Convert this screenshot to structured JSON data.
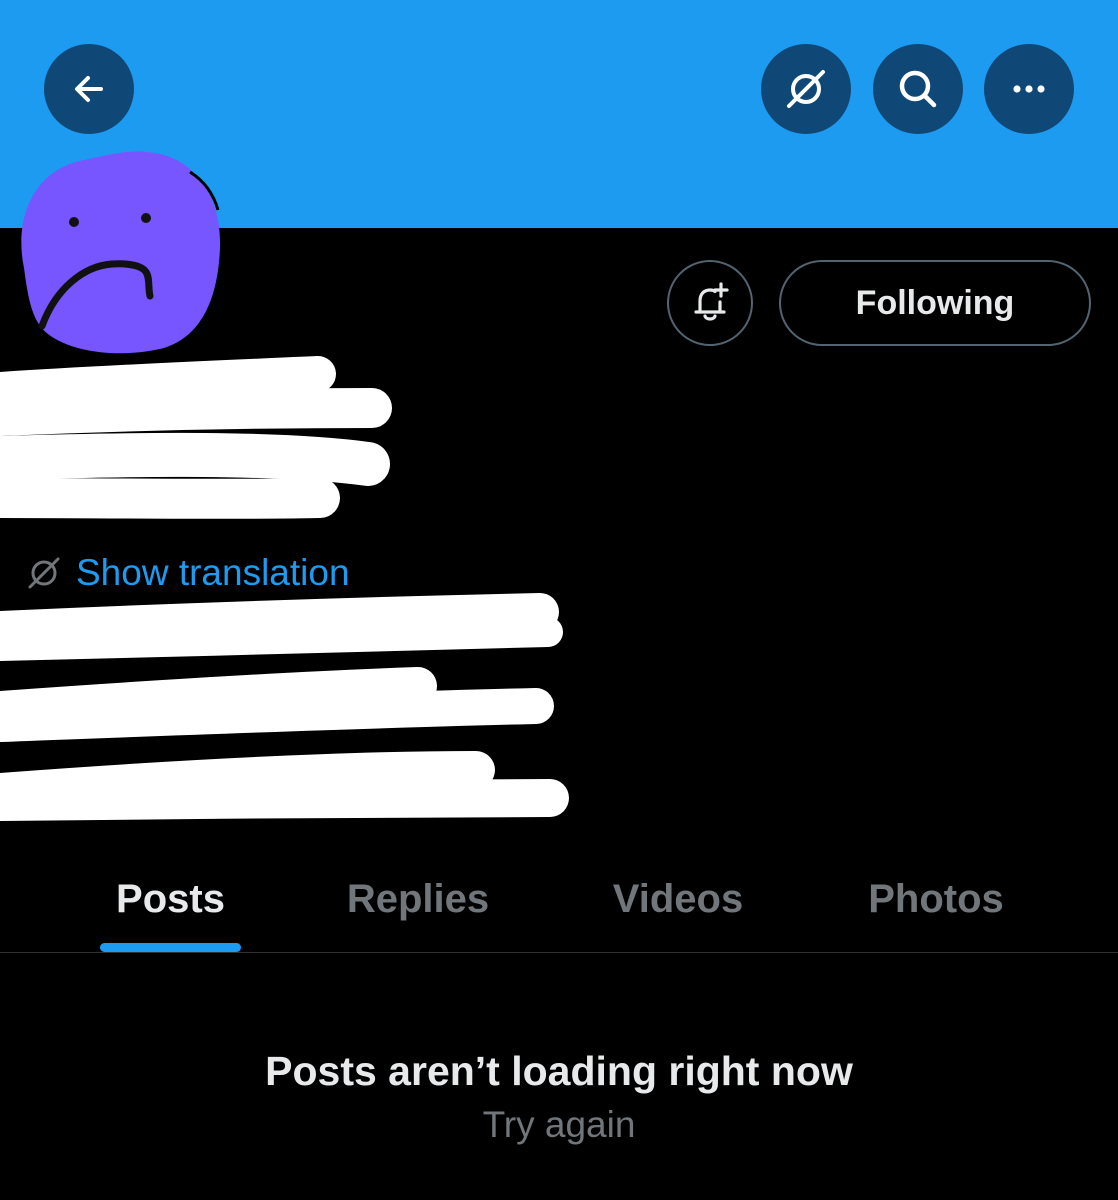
{
  "header": {
    "banner_color": "#1d9bf0",
    "back_icon": "arrow-left-icon",
    "actions": [
      {
        "name": "translate",
        "icon": "translate-slash-icon"
      },
      {
        "name": "search",
        "icon": "search-icon"
      },
      {
        "name": "more",
        "icon": "more-horizontal-icon"
      }
    ]
  },
  "profile": {
    "avatar_color": "#7755ff",
    "notification_icon": "bell-plus-icon",
    "follow_button_label": "Following",
    "translation_label": "Show translation",
    "translation_icon": "translate-slash-icon"
  },
  "tabs": [
    {
      "label": "Posts",
      "active": true
    },
    {
      "label": "Replies",
      "active": false
    },
    {
      "label": "Videos",
      "active": false
    },
    {
      "label": "Photos",
      "active": false
    }
  ],
  "timeline": {
    "empty_title": "Posts aren’t loading right now",
    "retry_label": "Try again"
  },
  "colors": {
    "accent": "#1d9bf0",
    "background": "#000000",
    "primary_text": "#e7e9ea",
    "secondary_text": "#71767b",
    "border": "#536471"
  }
}
